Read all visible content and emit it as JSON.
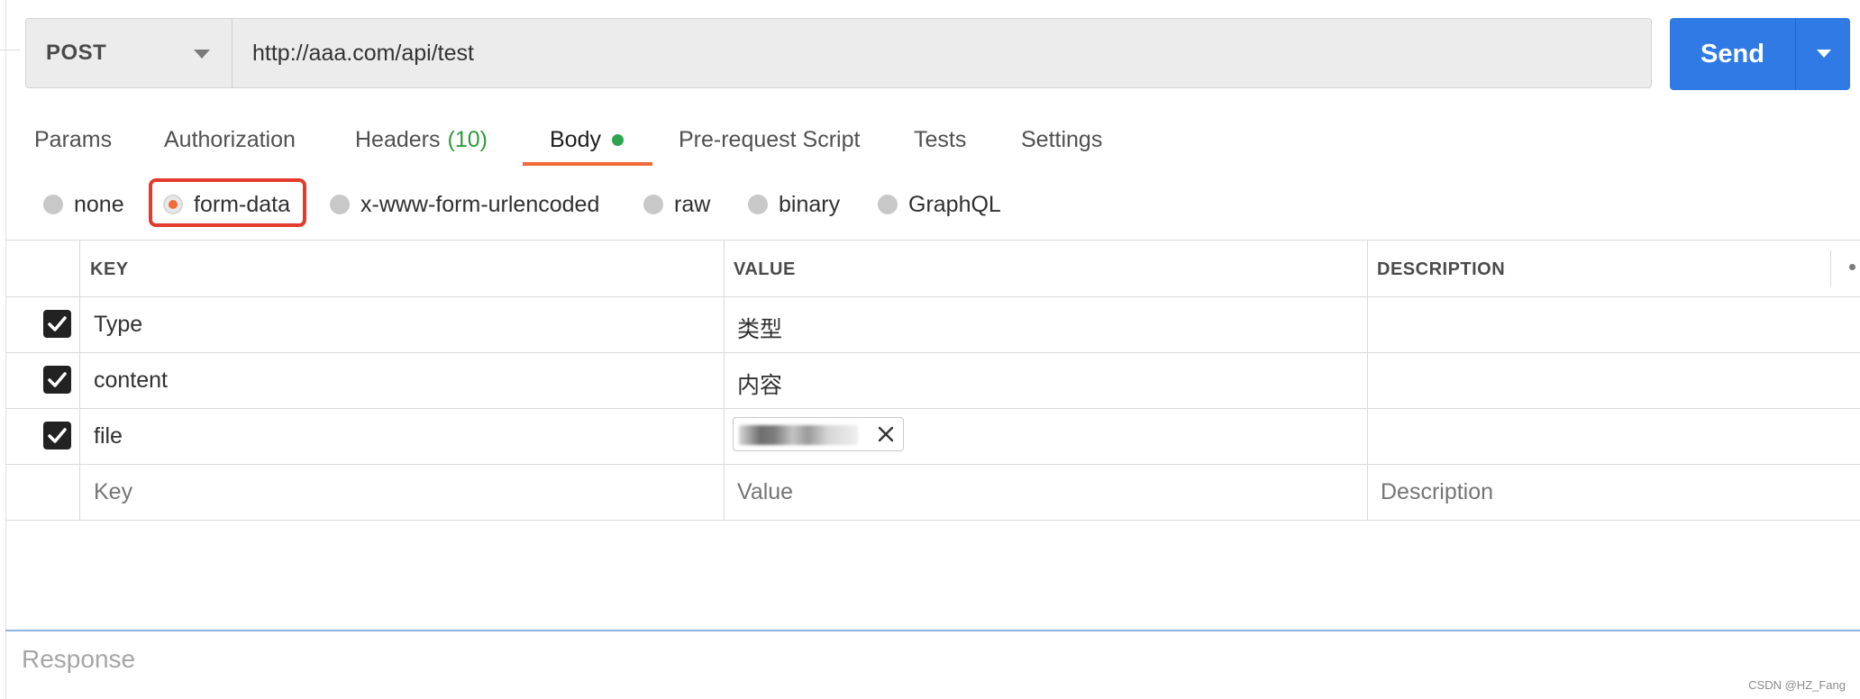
{
  "request": {
    "method": "POST",
    "url": "http://aaa.com/api/test",
    "send_label": "Send"
  },
  "tabs": [
    {
      "label": "Params"
    },
    {
      "label": "Authorization"
    },
    {
      "label": "Headers",
      "count": "(10)"
    },
    {
      "label": "Body",
      "active": true
    },
    {
      "label": "Pre-request Script"
    },
    {
      "label": "Tests"
    },
    {
      "label": "Settings"
    }
  ],
  "body_types": [
    {
      "label": "none"
    },
    {
      "label": "form-data",
      "selected": true
    },
    {
      "label": "x-www-form-urlencoded"
    },
    {
      "label": "raw"
    },
    {
      "label": "binary"
    },
    {
      "label": "GraphQL"
    }
  ],
  "table": {
    "headers": {
      "key": "KEY",
      "value": "VALUE",
      "description": "DESCRIPTION"
    },
    "rows": [
      {
        "checked": true,
        "key": "Type",
        "value": "类型",
        "description": ""
      },
      {
        "checked": true,
        "key": "content",
        "value": "内容",
        "description": ""
      },
      {
        "checked": true,
        "key": "file",
        "value_type": "file (filename blurred)",
        "description": ""
      }
    ],
    "placeholders": {
      "key": "Key",
      "value": "Value",
      "description": "Description"
    }
  },
  "response": {
    "label": "Response"
  },
  "watermark": "CSDN @HZ_Fang",
  "colors": {
    "accent_blue": "#2f7ae5",
    "tab_underline": "#f26b3a",
    "radio_selected": "#f26b3a",
    "highlight_box": "#e33a2c",
    "body_dot": "#2ea44f",
    "headers_count": "#2f9a3a"
  },
  "icons": [
    "caret-down-icon",
    "checkmark-icon",
    "close-icon",
    "more-dot-icon"
  ]
}
